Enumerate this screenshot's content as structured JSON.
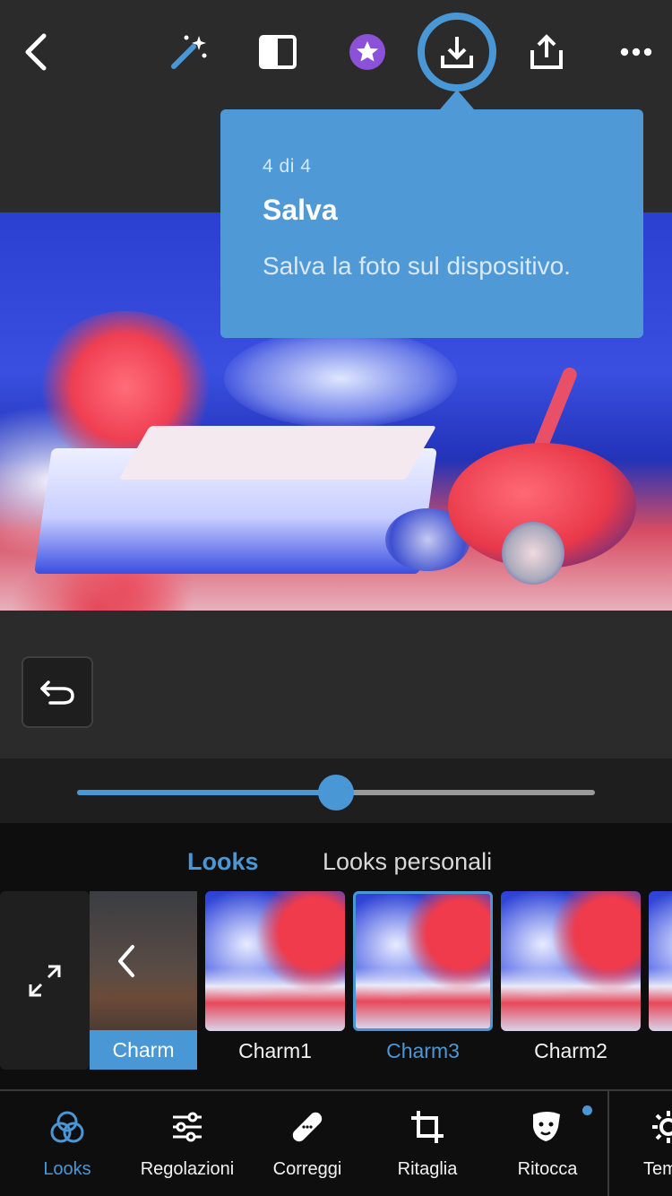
{
  "toolbar": {
    "back_icon": "chevron-left-icon",
    "auto_icon": "magic-wand-icon",
    "compare_icon": "compare-icon",
    "premium_icon": "star-badge-icon",
    "save_icon": "download-icon",
    "share_icon": "share-icon",
    "more_icon": "more-icon"
  },
  "tooltip": {
    "step": "4 di 4",
    "title": "Salva",
    "body": "Salva la foto sul dispositivo."
  },
  "undo_icon": "undo-icon",
  "slider": {
    "value": 0.5
  },
  "looks": {
    "tabs": [
      {
        "label": "Looks",
        "active": true
      },
      {
        "label": "Looks personali",
        "active": false
      }
    ],
    "back_label": "Charm",
    "items": [
      {
        "label": "Charm1",
        "selected": false
      },
      {
        "label": "Charm3",
        "selected": true
      },
      {
        "label": "Charm2",
        "selected": false
      }
    ]
  },
  "nav": {
    "items": [
      {
        "label": "Looks",
        "icon": "looks-icon",
        "active": true
      },
      {
        "label": "Regolazioni",
        "icon": "sliders-icon",
        "active": false
      },
      {
        "label": "Correggi",
        "icon": "bandage-icon",
        "active": false
      },
      {
        "label": "Ritaglia",
        "icon": "crop-icon",
        "active": false
      },
      {
        "label": "Ritocca",
        "icon": "retouch-icon",
        "active": false
      },
      {
        "label": "Tem",
        "icon": "gear-icon",
        "active": false
      }
    ]
  },
  "colors": {
    "accent": "#4a97d6",
    "tooltip": "#4f9ad6",
    "premium": "#8b52d8"
  }
}
